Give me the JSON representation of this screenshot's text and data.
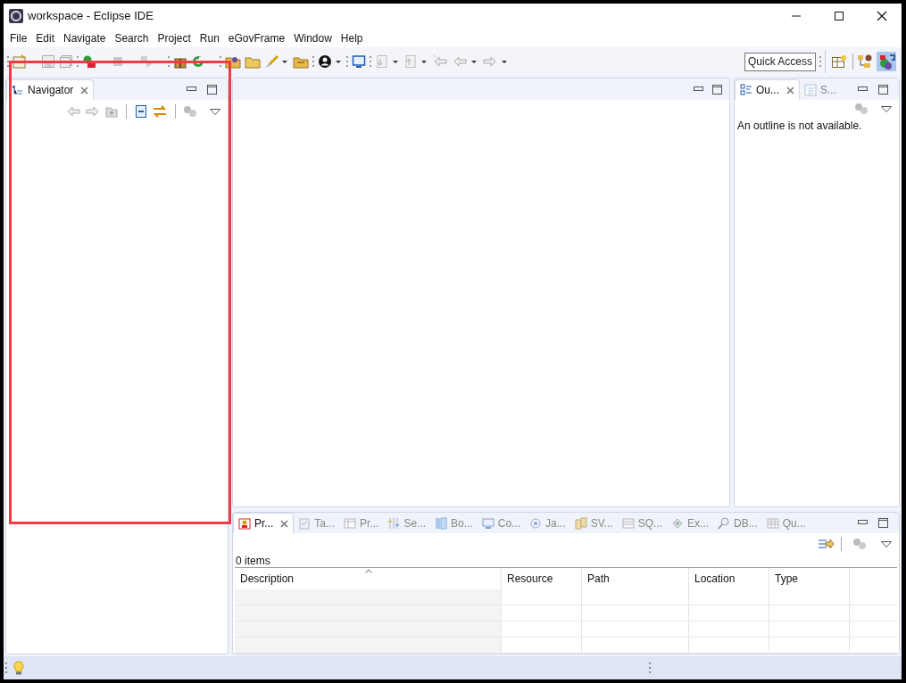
{
  "window": {
    "title": "workspace - Eclipse IDE"
  },
  "menu": [
    "File",
    "Edit",
    "Navigate",
    "Search",
    "Project",
    "Run",
    "eGovFrame",
    "Window",
    "Help"
  ],
  "quick_access": {
    "label": "Quick Access"
  },
  "navigator": {
    "tabs": [
      {
        "label": "Navigator",
        "selected": true
      }
    ]
  },
  "outline": {
    "tabs": [
      {
        "label": "Ou...",
        "selected": true
      },
      {
        "label": "S...",
        "selected": false
      }
    ],
    "message": "An outline is not available."
  },
  "bottom": {
    "tabs": [
      {
        "label": "Pr...",
        "selected": true
      },
      {
        "label": "Ta...",
        "selected": false
      },
      {
        "label": "Pr...",
        "selected": false
      },
      {
        "label": "Se...",
        "selected": false
      },
      {
        "label": "Bo...",
        "selected": false
      },
      {
        "label": "Co...",
        "selected": false
      },
      {
        "label": "Ja...",
        "selected": false
      },
      {
        "label": "SV...",
        "selected": false
      },
      {
        "label": "SQ...",
        "selected": false
      },
      {
        "label": "Ex...",
        "selected": false
      },
      {
        "label": "DB...",
        "selected": false
      },
      {
        "label": "Qu...",
        "selected": false
      }
    ],
    "count": "0 items",
    "columns": [
      "Description",
      "Resource",
      "Path",
      "Location",
      "Type"
    ]
  }
}
